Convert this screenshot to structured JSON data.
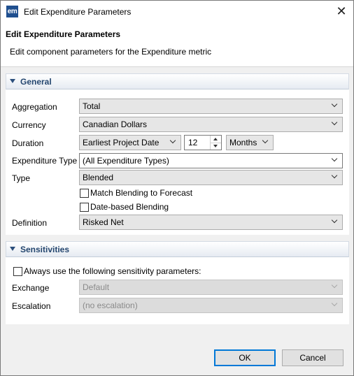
{
  "window": {
    "app_icon_text": "em",
    "title": "Edit Expenditure Parameters",
    "close_glyph": "✕"
  },
  "header": {
    "title": "Edit Expenditure Parameters",
    "description": "Edit component parameters for the Expenditure metric"
  },
  "general": {
    "section_label": "General",
    "aggregation": {
      "label": "Aggregation",
      "value": "Total"
    },
    "currency": {
      "label": "Currency",
      "value": "Canadian Dollars"
    },
    "duration": {
      "label": "Duration",
      "start_value": "Earliest Project Date",
      "count_value": "12",
      "unit_value": "Months"
    },
    "expenditure_type": {
      "label": "Expenditure Type",
      "value": "(All Expenditure Types)"
    },
    "type": {
      "label": "Type",
      "value": "Blended"
    },
    "match_blending": {
      "label": "Match Blending to Forecast",
      "checked": false
    },
    "date_based_blending": {
      "label": "Date-based Blending",
      "checked": false
    },
    "definition": {
      "label": "Definition",
      "value": "Risked Net"
    }
  },
  "sensitivities": {
    "section_label": "Sensitivities",
    "always_use": {
      "label": "Always use the following sensitivity parameters:",
      "checked": false
    },
    "exchange": {
      "label": "Exchange",
      "value": "Default"
    },
    "escalation": {
      "label": "Escalation",
      "value": "(no escalation)"
    }
  },
  "footer": {
    "ok_label": "OK",
    "cancel_label": "Cancel"
  },
  "colors": {
    "accent": "#0078d7",
    "section_title": "#24466f",
    "icon_bg": "#1f4f8f"
  }
}
